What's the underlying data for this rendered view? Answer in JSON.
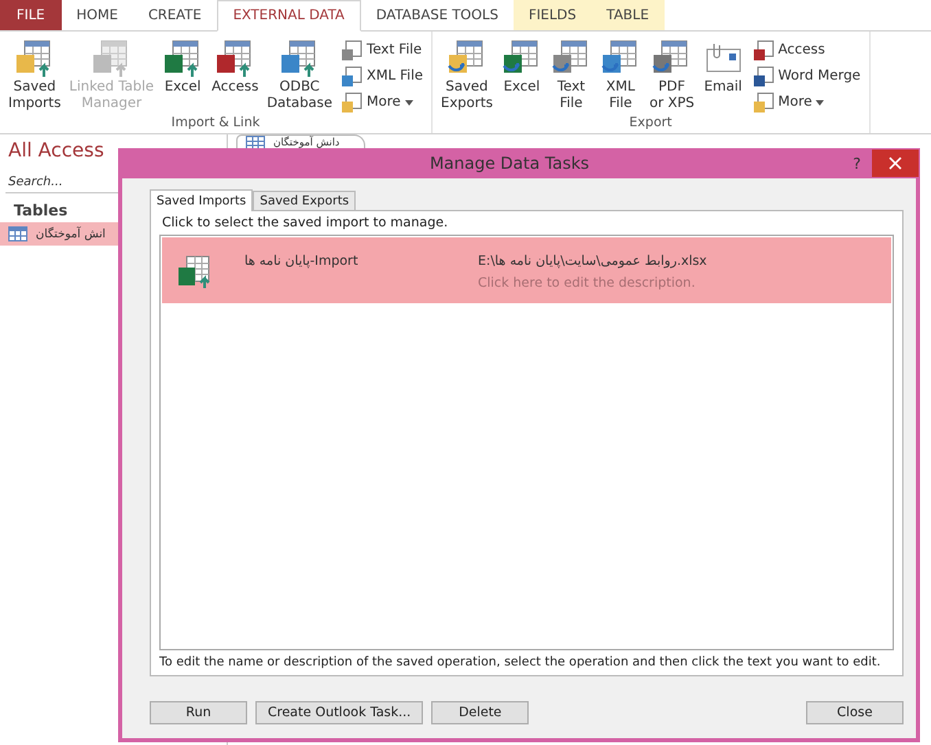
{
  "ribbon_tabs": [
    {
      "label": "FILE",
      "kind": "file",
      "selected": false
    },
    {
      "label": "HOME",
      "kind": "normal",
      "selected": false
    },
    {
      "label": "CREATE",
      "kind": "normal",
      "selected": false
    },
    {
      "label": "EXTERNAL DATA",
      "kind": "normal",
      "selected": true
    },
    {
      "label": "DATABASE TOOLS",
      "kind": "normal",
      "selected": false
    },
    {
      "label": "FIELDS",
      "kind": "contextual",
      "selected": false
    },
    {
      "label": "TABLE",
      "kind": "contextual",
      "selected": false
    }
  ],
  "ribbon_groups": [
    {
      "label": "Import & Link",
      "large": [
        {
          "lines": [
            "Saved",
            "Imports"
          ],
          "kind": "saved-import",
          "disabled": false
        },
        {
          "lines": [
            "Linked Table",
            "Manager"
          ],
          "kind": "linked",
          "disabled": true
        },
        {
          "lines": [
            "Excel"
          ],
          "kind": "excel",
          "disabled": false
        },
        {
          "lines": [
            "Access"
          ],
          "kind": "access",
          "disabled": false
        },
        {
          "lines": [
            "ODBC",
            "Database"
          ],
          "kind": "odbc",
          "disabled": false
        }
      ],
      "small": [
        {
          "label": "Text File",
          "kind": "text",
          "dropdown": false
        },
        {
          "label": "XML File",
          "kind": "xml",
          "dropdown": false
        },
        {
          "label": "More",
          "kind": "more",
          "dropdown": true
        }
      ]
    },
    {
      "label": "Export",
      "large": [
        {
          "lines": [
            "Saved",
            "Exports"
          ],
          "kind": "saved-export",
          "disabled": false
        },
        {
          "lines": [
            "Excel"
          ],
          "kind": "excel-export",
          "disabled": false
        },
        {
          "lines": [
            "Text",
            "File"
          ],
          "kind": "text-export",
          "disabled": false
        },
        {
          "lines": [
            "XML",
            "File"
          ],
          "kind": "xml-export",
          "disabled": false
        },
        {
          "lines": [
            "PDF",
            "or XPS"
          ],
          "kind": "pdf",
          "disabled": false
        },
        {
          "lines": [
            "Email"
          ],
          "kind": "email",
          "disabled": false
        }
      ],
      "small": [
        {
          "label": "Access",
          "kind": "access-small",
          "dropdown": false
        },
        {
          "label": "Word Merge",
          "kind": "word",
          "dropdown": false
        },
        {
          "label": "More",
          "kind": "more-export",
          "dropdown": true
        }
      ]
    }
  ],
  "nav_pane": {
    "title": "All Access",
    "search": {
      "placeholder": "Search..."
    },
    "section": "Tables",
    "items": [
      {
        "label": "انش آموختگان",
        "selected": true
      }
    ]
  },
  "document_tab": {
    "label": "دانش آموختگان"
  },
  "dialog": {
    "title": "Manage Data Tasks",
    "help": "?",
    "tabs": [
      {
        "label": "Saved Imports",
        "selected": true
      },
      {
        "label": "Saved Exports",
        "selected": false
      }
    ],
    "instruction": "Click to select the saved import to manage.",
    "items": [
      {
        "name": "پایان نامه ها-Import",
        "path": "E:\\روابط عمومی\\سایت\\پایان نامه ها.xlsx",
        "description": "Click here to edit the description.",
        "selected": true
      }
    ],
    "hint": "To edit the name or description of the saved operation, select the operation and then click the text you want to edit.",
    "buttons": [
      {
        "label": "Run",
        "kind": "left"
      },
      {
        "label": "Create Outlook Task...",
        "kind": "left"
      },
      {
        "label": "Delete",
        "kind": "left"
      },
      {
        "label": "Close",
        "kind": "right"
      }
    ]
  }
}
